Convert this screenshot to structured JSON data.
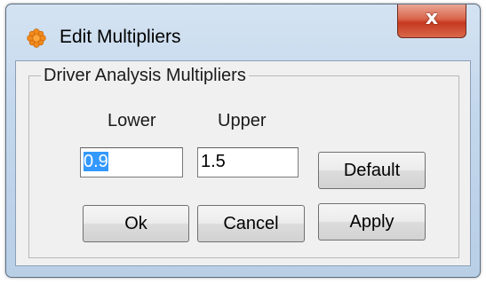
{
  "window": {
    "title": "Edit Multipliers",
    "close_label": "x",
    "accent_close_color": "#d9634a",
    "frame_color": "#c3d7ec"
  },
  "group": {
    "label": "Driver Analysis Multipliers"
  },
  "fields": {
    "lower_label": "Lower",
    "upper_label": "Upper",
    "lower_value": "0.9",
    "upper_value": "1.5"
  },
  "buttons": {
    "default_label": "Default",
    "ok_label": "Ok",
    "cancel_label": "Cancel",
    "apply_label": "Apply"
  },
  "icons": {
    "app": "gear-flower-icon",
    "close": "close-icon"
  }
}
